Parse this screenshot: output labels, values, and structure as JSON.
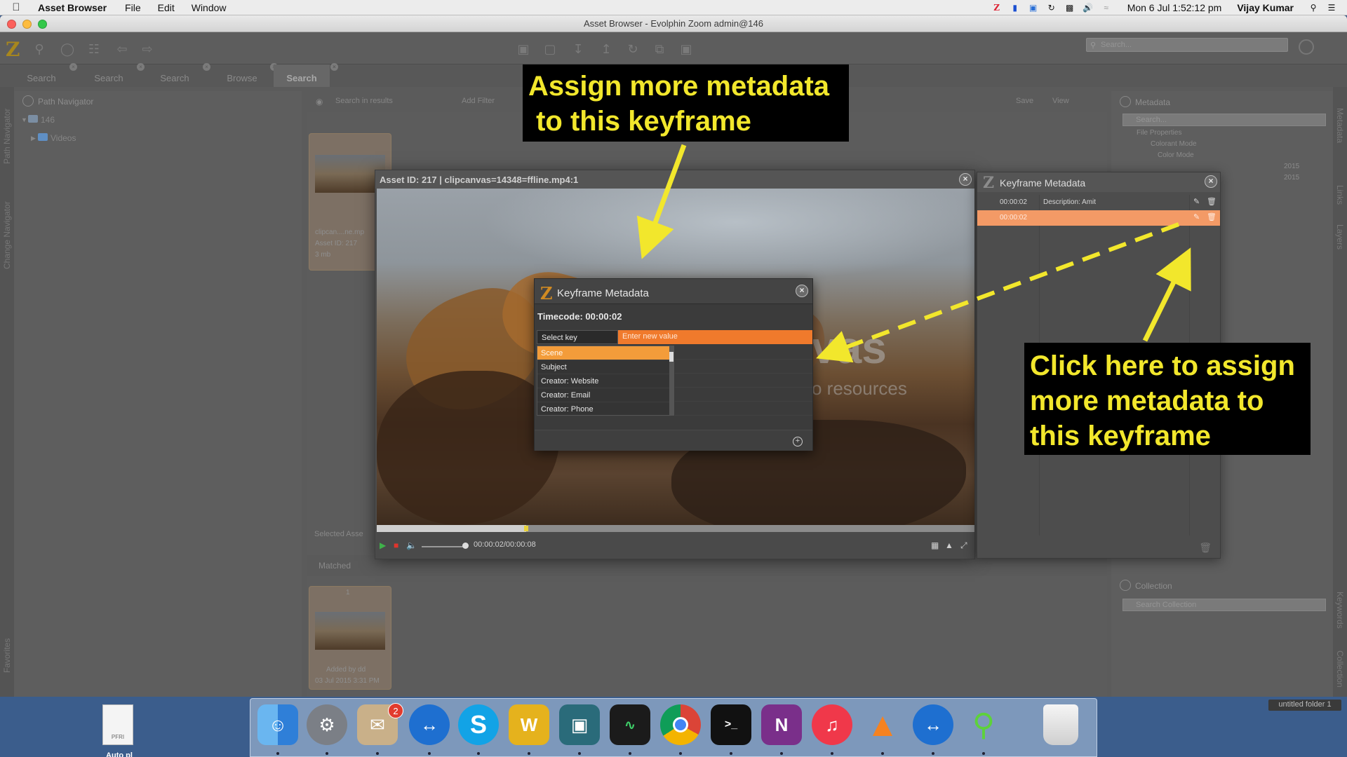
{
  "menubar": {
    "app_name": "Asset Browser",
    "menus": [
      "File",
      "Edit",
      "Window"
    ],
    "clock": "Mon 6 Jul  1:52:12 pm",
    "user": "Vijay Kumar"
  },
  "window": {
    "title": "Asset Browser - Evolphin Zoom admin@146"
  },
  "toolbar": {
    "search_placeholder": "Search..."
  },
  "tabs": [
    {
      "label": "Search"
    },
    {
      "label": "Search"
    },
    {
      "label": "Search"
    },
    {
      "label": "Browse"
    },
    {
      "label": "Search",
      "active": true
    }
  ],
  "side_labels": {
    "left_top": "Path Navigator",
    "left_mid": "Change Navigator",
    "left_bottom": "Favorites",
    "right_metadata": "Metadata",
    "right_links": "Links",
    "right_layers": "Layers",
    "right_keywords": "Keywords",
    "right_collection": "Collection"
  },
  "path_navigator": {
    "title": "Path Navigator",
    "tree": [
      {
        "label": "146",
        "level": 0
      },
      {
        "label": "Videos",
        "level": 1
      }
    ]
  },
  "center": {
    "search_placeholder": "Search in results",
    "add_filter": "Add Filter",
    "save": "Save",
    "view": "View",
    "selected_label": "Selected Asse",
    "matched_label": "Matched",
    "card_top": {
      "name": "clipcan....ne.mp",
      "asset_id": "Asset ID: 217",
      "size": "3 mb"
    },
    "card_bottom": {
      "number": "1",
      "added_by": "Added by dd",
      "date": "03 Jul 2015 3:31 PM"
    }
  },
  "right_panel": {
    "metadata_title": "Metadata",
    "metadata_search": "Search...",
    "file_properties": "File Properties",
    "colorant_mode": "Colorant Mode",
    "color_mode": "Color Mode",
    "date_a": "2015",
    "date_b": "2015",
    "collection_title": "Collection",
    "collection_search": "Search Collection"
  },
  "viewer": {
    "title": "Asset ID: 217 | clipcanvas=14348=ffline.mp4:1",
    "watermark_a": "vas",
    "watermark_b": "o resources",
    "time": "00:00:02/00:00:08",
    "progress_fraction": 0.25
  },
  "kf_dialog": {
    "title": "Keyframe Metadata",
    "timecode": "Timecode: 00:00:02",
    "select_key": "Select key",
    "value_placeholder": "Enter new value",
    "options": [
      "Scene",
      "Subject",
      "Creator: Website",
      "Creator: Email",
      "Creator: Phone"
    ],
    "selected_option": "Scene"
  },
  "kf_panel": {
    "title": "Keyframe Metadata",
    "rows": [
      {
        "timecode": "00:00:02",
        "description": "Description: Amit"
      },
      {
        "timecode": "00:00:02",
        "description": ""
      }
    ]
  },
  "callouts": {
    "top_line1": "Assign more metadata",
    "top_line2": " to this keyframe",
    "right_line1": "Click here to assign",
    "right_line2": "more metadata to",
    "right_line3": "this keyframe"
  },
  "desktop": {
    "file_name": "PFRI",
    "file_label": "Auto pl",
    "folder_label": "untitled folder 1",
    "mail_badge": "2"
  },
  "colors": {
    "accent_orange": "#f07a2c",
    "callout_text": "#f2e72c",
    "callout_bg": "#000000",
    "selected_row": "#f39a66"
  }
}
